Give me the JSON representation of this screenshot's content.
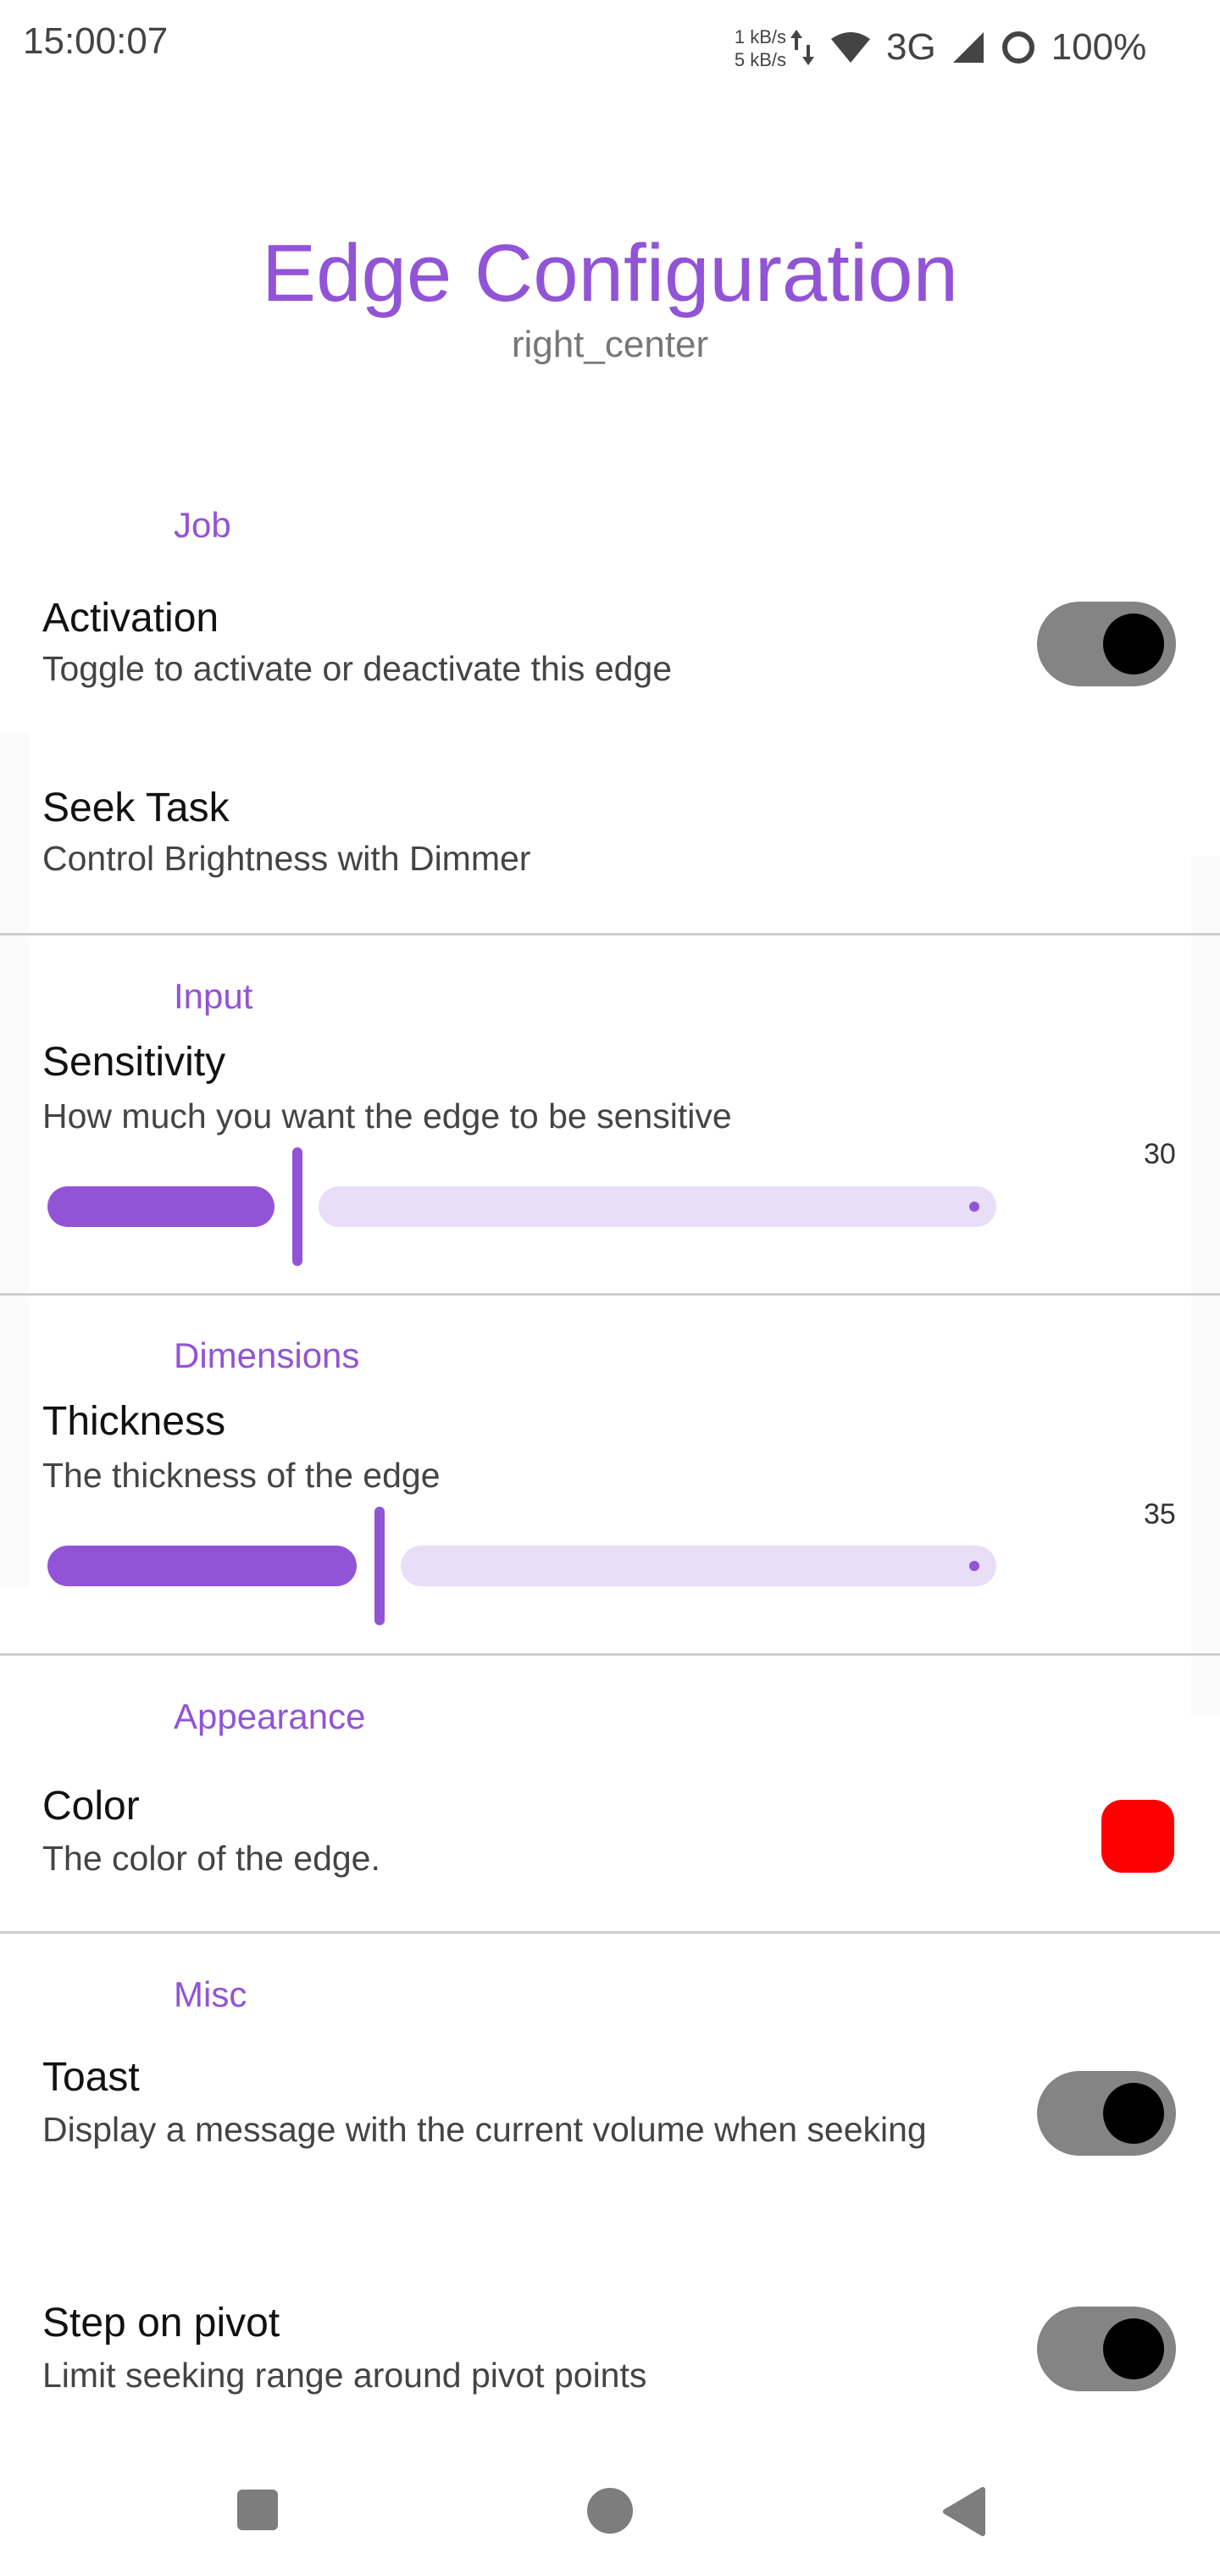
{
  "status_bar": {
    "time": "15:00:07",
    "net_up": "1 kB/s",
    "net_down": "5 kB/s",
    "network": "3G",
    "battery": "100%"
  },
  "header": {
    "title": "Edge Configuration",
    "subtitle": "right_center"
  },
  "sections": {
    "job": {
      "title": "Job",
      "activation": {
        "title": "Activation",
        "subtitle": "Toggle to activate or deactivate this edge",
        "on": true
      },
      "seek_task": {
        "title": "Seek Task",
        "subtitle": "Control Brightness with Dimmer"
      }
    },
    "input": {
      "title": "Input",
      "sensitivity": {
        "title": "Sensitivity",
        "subtitle": "How much you want the edge to be sensitive",
        "value": "30",
        "fraction": 0.26
      }
    },
    "dimensions": {
      "title": "Dimensions",
      "thickness": {
        "title": "Thickness",
        "subtitle": "The thickness of the edge",
        "value": "35",
        "fraction": 0.35
      }
    },
    "appearance": {
      "title": "Appearance",
      "color": {
        "title": "Color",
        "subtitle": "The color of the edge.",
        "value": "#ff0000"
      }
    },
    "misc": {
      "title": "Misc",
      "toast": {
        "title": "Toast",
        "subtitle": "Display a message with the current volume when seeking",
        "on": true
      },
      "step_on_pivot": {
        "title": "Step on pivot",
        "subtitle": "Limit seeking range around pivot points",
        "on": true
      }
    }
  },
  "colors": {
    "accent": "#9254d6",
    "accent_light": "#e8def8",
    "switch_track": "#848484"
  },
  "nav_bar": {
    "recents_icon": "square-icon",
    "home_icon": "circle-icon",
    "back_icon": "triangle-icon"
  }
}
